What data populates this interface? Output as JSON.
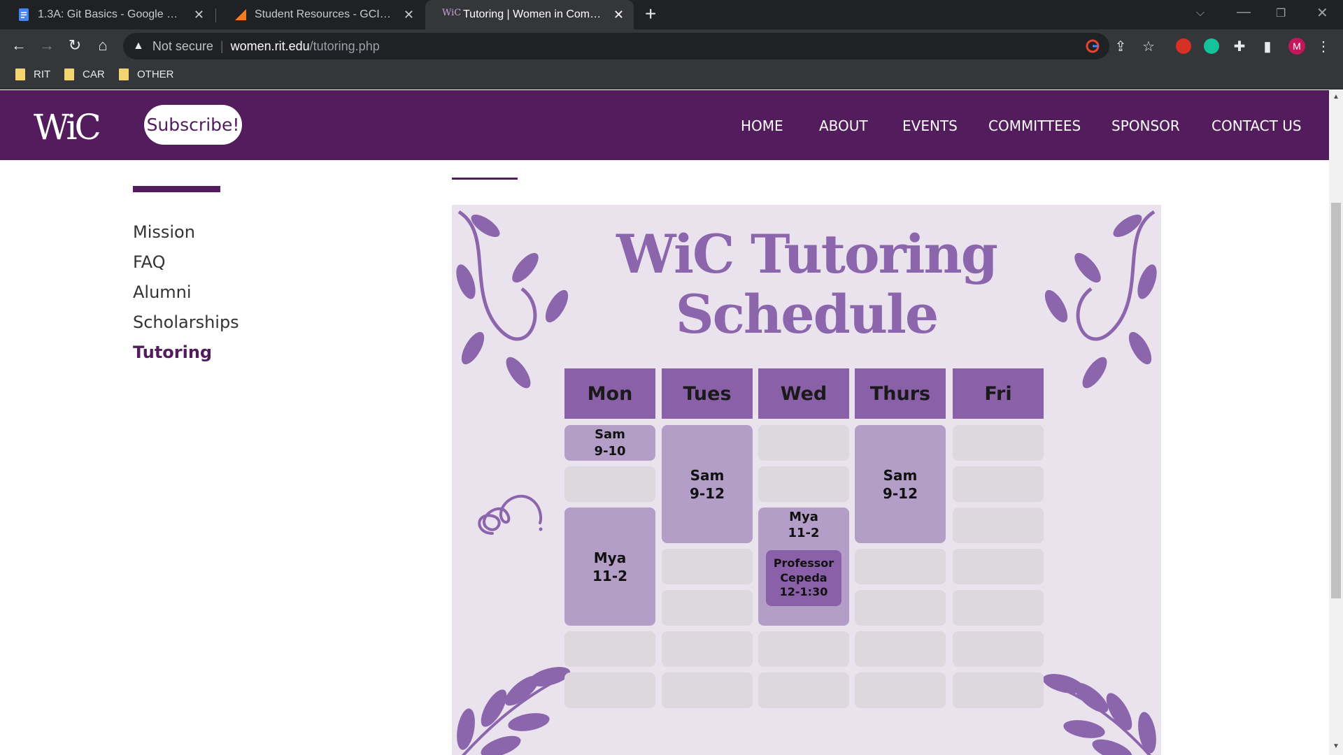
{
  "browser": {
    "tabs": [
      {
        "title": "1.3A: Git Basics - Google Docs",
        "active": false
      },
      {
        "title": "Student Resources - GCIS.123.01",
        "active": false
      },
      {
        "title": "Tutoring | Women in Computing",
        "active": true
      }
    ],
    "address": {
      "security_label": "Not secure",
      "host": "women.rit.edu",
      "path": "/tutoring.php"
    },
    "profile_initial": "M",
    "bookmarks": [
      "RIT",
      "CAR",
      "OTHER"
    ]
  },
  "site": {
    "logo_text": "WiC",
    "subscribe_label": "Subscribe!",
    "nav": [
      "HOME",
      "ABOUT",
      "EVENTS",
      "COMMITTEES",
      "SPONSOR",
      "CONTACT US"
    ]
  },
  "sidebar": {
    "links": [
      "Mission",
      "FAQ",
      "Alumni",
      "Scholarships",
      "Tutoring"
    ],
    "active": "Tutoring"
  },
  "schedule": {
    "title_line1": "WiC Tutoring",
    "title_line2": "Schedule",
    "days": [
      "Mon",
      "Tues",
      "Wed",
      "Thurs",
      "Fri"
    ],
    "sessions": {
      "mon_1": {
        "name": "Sam",
        "time": "9-10"
      },
      "mon_2": {
        "name": "Mya",
        "time": "11-2"
      },
      "tues_1": {
        "name": "Sam",
        "time": "9-12"
      },
      "wed_1": {
        "name": "Mya",
        "time": "11-2"
      },
      "wed_2": {
        "line1": "Professor",
        "line2": "Cepeda",
        "time": "12-1:30"
      },
      "thurs_1": {
        "name": "Sam",
        "time": "9-12"
      }
    }
  },
  "colors": {
    "brand_purple": "#521c5d",
    "poster_bg": "#eae2ec",
    "day_header": "#8a60a8",
    "session_block": "#b39ec8",
    "empty_slot": "#ddd7de"
  }
}
